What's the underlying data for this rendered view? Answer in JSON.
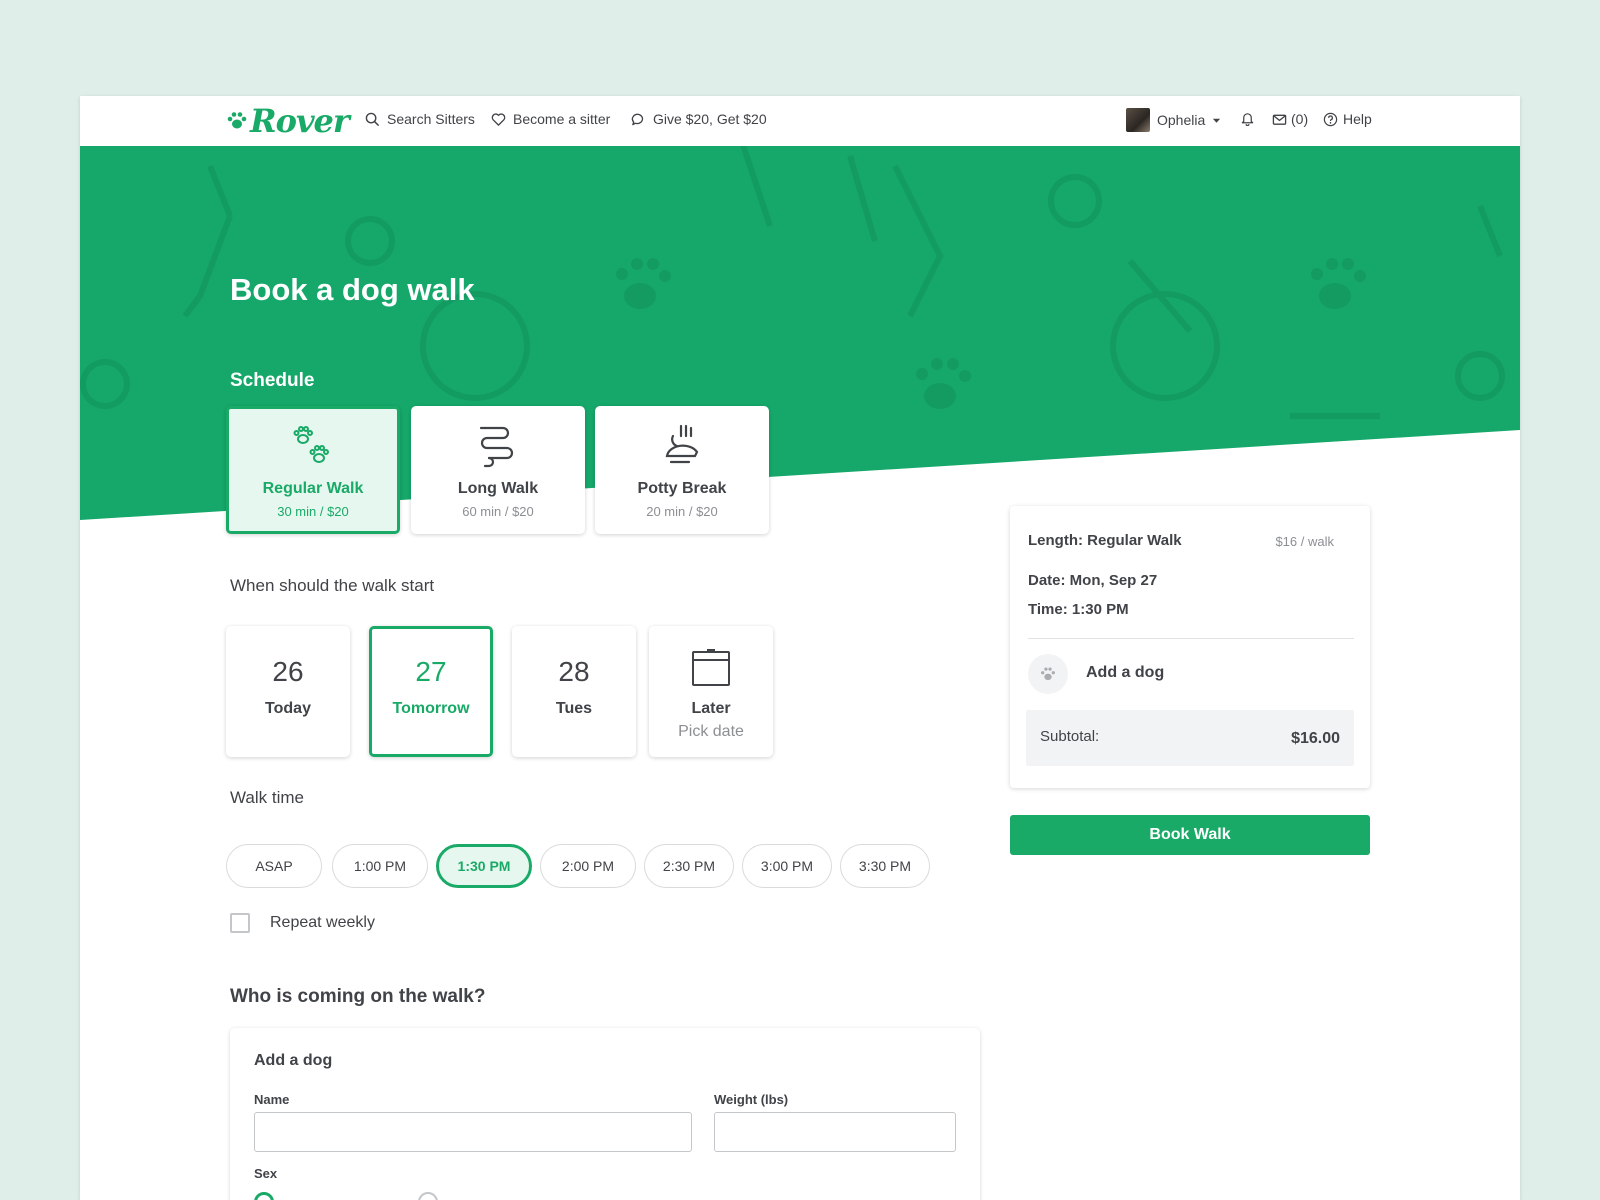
{
  "header": {
    "logo": "Rover",
    "nav": [
      {
        "label": "Search Sitters",
        "icon": "search-icon"
      },
      {
        "label": "Become a sitter",
        "icon": "heart-icon"
      },
      {
        "label": "Give $20, Get $20",
        "icon": "chat-bubble-icon"
      }
    ],
    "user_name": "Ophelia",
    "messages_count": "(0)",
    "help": "Help"
  },
  "hero": {
    "title": "Book a dog walk",
    "schedule_label": "Schedule"
  },
  "services": [
    {
      "name": "Regular Walk",
      "detail": "30 min / $20",
      "icon": "paw-prints-icon",
      "selected": true
    },
    {
      "name": "Long Walk",
      "detail": "60 min / $20",
      "icon": "leash-icon",
      "selected": false
    },
    {
      "name": "Potty Break",
      "detail": "20 min / $20",
      "icon": "potty-icon",
      "selected": false
    }
  ],
  "date_section": {
    "label": "When should the walk start",
    "dates": [
      {
        "number": "26",
        "day": "Today",
        "selected": false
      },
      {
        "number": "27",
        "day": "Tomorrow",
        "selected": true
      },
      {
        "number": "28",
        "day": "Tues",
        "selected": false
      }
    ],
    "later": {
      "day": "Later",
      "sub": "Pick date",
      "icon": "calendar-icon"
    }
  },
  "time_section": {
    "label": "Walk time",
    "times": [
      "ASAP",
      "1:00 PM",
      "1:30 PM",
      "2:00 PM",
      "2:30 PM",
      "3:00 PM",
      "3:30 PM"
    ],
    "selected": "1:30 PM",
    "repeat_label": "Repeat weekly",
    "repeat_checked": false
  },
  "dog_section": {
    "title": "Who is coming on the walk?",
    "form_title": "Add a dog",
    "name_label": "Name",
    "name_value": "",
    "weight_label": "Weight (lbs)",
    "weight_value": "",
    "sex_label": "Sex"
  },
  "summary": {
    "length": "Length: Regular Walk",
    "price_per": "$16 / walk",
    "date": "Date: Mon, Sep 27",
    "time": "Time: 1:30 PM",
    "add_dog": "Add a dog",
    "subtotal_label": "Subtotal:",
    "subtotal_amount": "$16.00",
    "book_button": "Book Walk"
  },
  "colors": {
    "brand_green": "#1aaa67",
    "selected_fill": "#e6f7ef",
    "background": "#dfeee8"
  }
}
